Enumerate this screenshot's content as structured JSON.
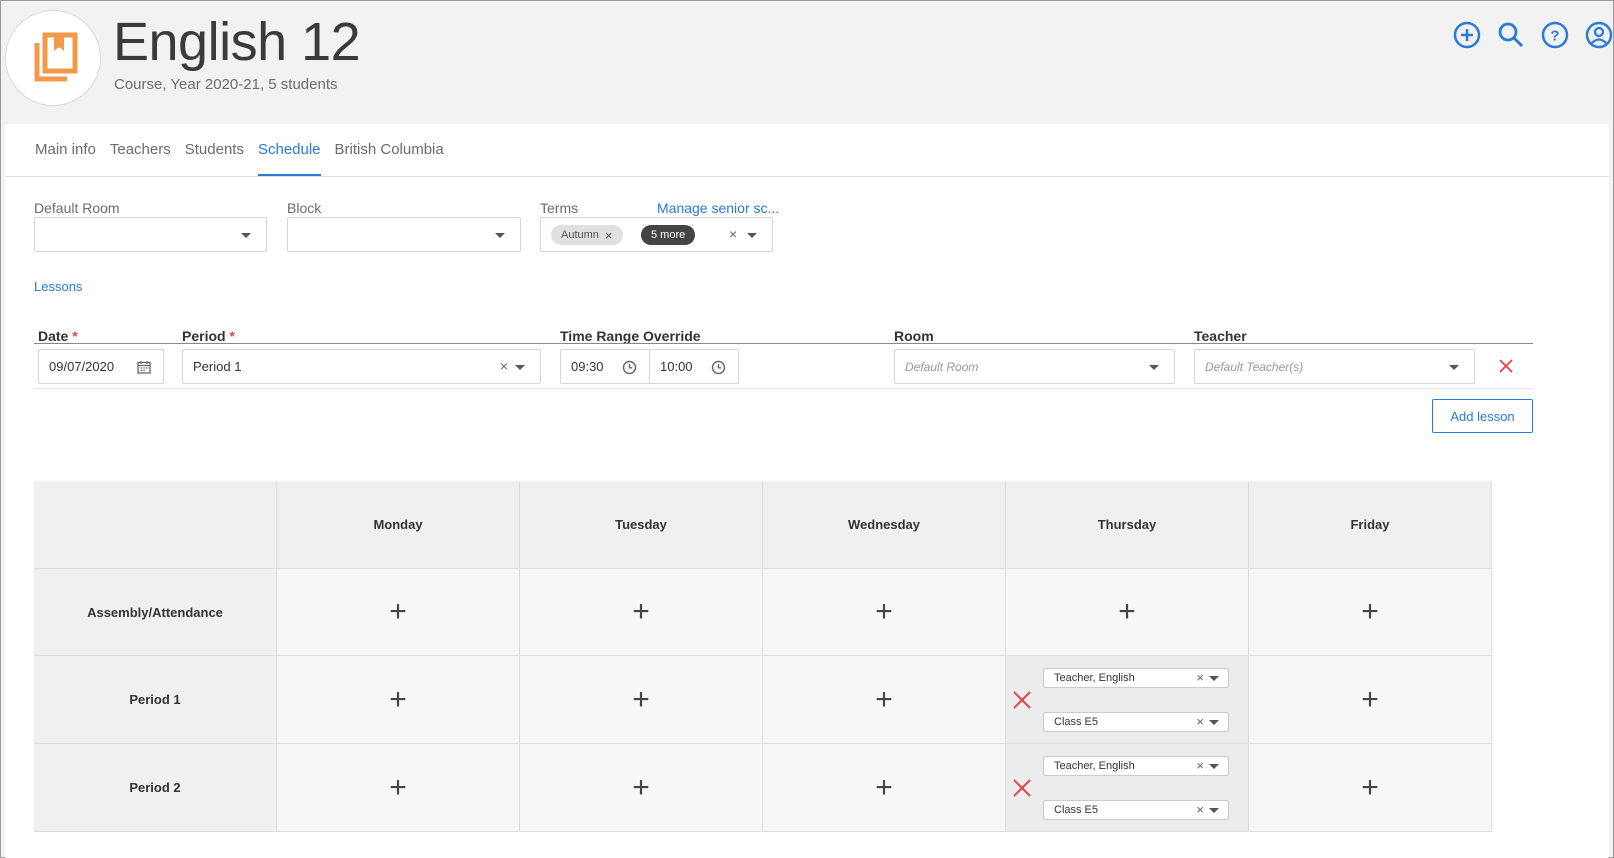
{
  "header": {
    "title": "English 12",
    "subtitle": "Course, Year 2020-21, 5 students",
    "icons": [
      "add-circle-icon",
      "search-icon",
      "help-icon",
      "account-icon"
    ]
  },
  "tabs": [
    {
      "label": "Main info",
      "active": false
    },
    {
      "label": "Teachers",
      "active": false
    },
    {
      "label": "Students",
      "active": false
    },
    {
      "label": "Schedule",
      "active": true
    },
    {
      "label": "British Columbia",
      "active": false
    }
  ],
  "fields": {
    "default_room": {
      "label": "Default Room",
      "value": ""
    },
    "block": {
      "label": "Block",
      "value": ""
    },
    "terms": {
      "label": "Terms",
      "chips": [
        "Autumn",
        "5 more"
      ],
      "link": "Manage senior sc..."
    }
  },
  "lessons": {
    "section_title": "Lessons",
    "columns": {
      "date": "Date",
      "period": "Period",
      "time_range": "Time Range Override",
      "room": "Room",
      "teacher": "Teacher"
    },
    "required_mark": "*",
    "row": {
      "date": "09/07/2020",
      "period": "Period 1",
      "time_start": "09:30",
      "time_end": "10:00",
      "room_placeholder": "Default Room",
      "teacher_placeholder": "Default Teacher(s)"
    },
    "add_button": "Add lesson"
  },
  "timetable": {
    "days": [
      "Monday",
      "Tuesday",
      "Wednesday",
      "Thursday",
      "Friday"
    ],
    "rows": [
      {
        "label": "Assembly/Attendance"
      },
      {
        "label": "Period 1",
        "thursday": {
          "teacher": "Teacher, English",
          "room": "Class E5"
        }
      },
      {
        "label": "Period 2",
        "thursday": {
          "teacher": "Teacher, English",
          "room": "Class E5"
        }
      }
    ]
  },
  "colors": {
    "accent": "#2a7bd4",
    "danger": "#e04444",
    "logo": "#f39a4a"
  }
}
